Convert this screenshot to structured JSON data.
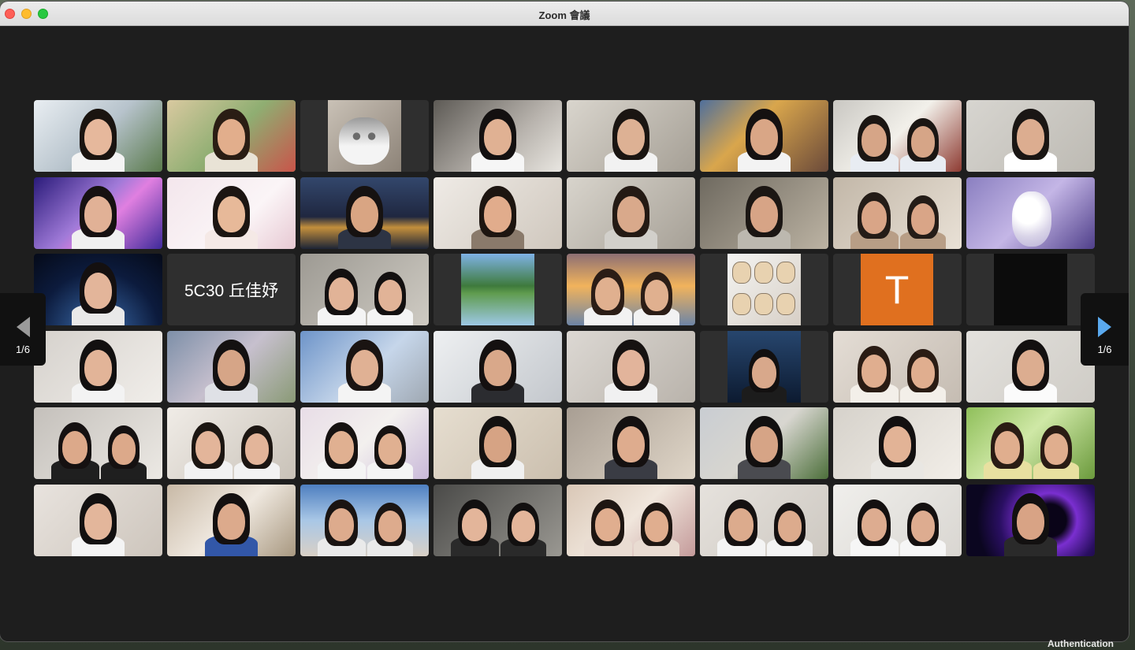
{
  "window": {
    "title": "Zoom 會議"
  },
  "navigation": {
    "prev_label": "1/6",
    "next_label": "1/6",
    "prev_icon": "chevron-left-icon",
    "next_icon": "chevron-right-icon"
  },
  "gallery": {
    "columns": 8,
    "rows": 6,
    "active_color": "#23d160",
    "tiles": [
      {
        "type": "video",
        "bg": "linear-gradient(135deg,#e9eef2,#b7c3cc 50%,#5a7a4c)",
        "people": 1,
        "skin": "#e6b89c",
        "hair": "#1a1410",
        "shirt": "#f4f4f4"
      },
      {
        "type": "video",
        "active": true,
        "bg": "linear-gradient(135deg,#d9c9a0,#8fae72 50%,#c9544a)",
        "people": 1,
        "skin": "#e2ae8c",
        "hair": "#2a1d14",
        "shirt": "#e9e3d6"
      },
      {
        "type": "video",
        "letterbox": true,
        "bg": "linear-gradient(135deg,#c9c1b6,#8d8378)",
        "people": 0,
        "extra": "cat"
      },
      {
        "type": "video",
        "bg": "linear-gradient(135deg,#5d5a55,#b8b3ad 60%,#e9e6e1)",
        "people": 1,
        "skin": "#e0b193",
        "hair": "#131010",
        "shirt": "#f6f6f6"
      },
      {
        "type": "video",
        "bg": "linear-gradient(135deg,#d9d5cd,#a59f95)",
        "people": 1,
        "skin": "#ddb194",
        "hair": "#1a1512",
        "shirt": "#f2f2f2"
      },
      {
        "type": "video",
        "bg": "linear-gradient(135deg,#4f6f9c,#d9a64c 40%,#6b4a3a)",
        "people": 1,
        "skin": "#d9a686",
        "hair": "#151111",
        "shirt": "#f3f3f3"
      },
      {
        "type": "video",
        "bg": "linear-gradient(135deg,#c9c7c2,#f2f0ea 50%,#8e3b32)",
        "people": 2,
        "skin": "#d6a587",
        "hair": "#1b1613",
        "shirt": "#e8ecf2"
      },
      {
        "type": "video",
        "bg": "linear-gradient(135deg,#d7d5d0,#bdbab3)",
        "people": 1,
        "skin": "#dcad90",
        "hair": "#1a1614",
        "shirt": "#ffffff"
      },
      {
        "type": "video",
        "bg": "linear-gradient(135deg,#2a1b7a,#a07ad8 45%,#e07fe0 60%,#3e2a9a)",
        "people": 1,
        "skin": "#e1b196",
        "hair": "#161111",
        "shirt": "#f0f0f0"
      },
      {
        "type": "video",
        "bg": "linear-gradient(135deg,#f3e6ec,#fbf5f7 60%,#e7c9d3)",
        "people": 1,
        "skin": "#e7b999",
        "hair": "#1c1512",
        "shirt": "#f5e9e6"
      },
      {
        "type": "video",
        "bg": "linear-gradient(180deg,#33476c,#1f2740 55%,#c38f3c 70%,#1d2436)",
        "people": 1,
        "skin": "#d9a583",
        "hair": "#161211",
        "shirt": "#2d3444"
      },
      {
        "type": "video",
        "bg": "linear-gradient(135deg,#efebe6,#cfc7bd)",
        "people": 1,
        "skin": "#e1ac8c",
        "hair": "#1d1510",
        "shirt": "#8a7a6b"
      },
      {
        "type": "video",
        "bg": "linear-gradient(135deg,#d8d4cc,#a6a096)",
        "people": 1,
        "skin": "#d9a98b",
        "hair": "#241a14",
        "shirt": "#d2d0cb"
      },
      {
        "type": "video",
        "bg": "linear-gradient(135deg,#6f6a60,#bcb3a3)",
        "people": 1,
        "skin": "#d7a486",
        "hair": "#1b1613",
        "shirt": "#bcb8af"
      },
      {
        "type": "video",
        "bg": "linear-gradient(135deg,#c2b7a8,#e9e1d6)",
        "people": 2,
        "skin": "#d9a587",
        "hair": "#241c17",
        "shirt": "#b89e86"
      },
      {
        "type": "video",
        "bg": "linear-gradient(135deg,#8a7fc0,#c4b6e6 50%,#4f3f8a)",
        "people": 0,
        "extra": "plush"
      },
      {
        "type": "video",
        "bg": "radial-gradient(circle at 50% 110%,#3d6fb0,#0c1b3d 60%,#050a18)",
        "people": 1,
        "skin": "#e3b59a",
        "hair": "#141010",
        "shirt": "#e9e9e9"
      },
      {
        "type": "name",
        "name": "5C30 丘佳妤"
      },
      {
        "type": "video",
        "bg": "linear-gradient(135deg,#9d9a93,#cfcbc3)",
        "people": 2,
        "skin": "#e1b397",
        "hair": "#131010",
        "shirt": "#f4f4f4"
      },
      {
        "type": "video",
        "letterbox": true,
        "bg": "linear-gradient(180deg,#7fb2e6,#3e7a3c 45%,#5f9b4e 55%,#9dc8e6)",
        "people": 0
      },
      {
        "type": "video",
        "bg": "linear-gradient(180deg,#8d6f74,#f1b35c 45%,#6d85a6)",
        "people": 2,
        "skin": "#e0b08f",
        "hair": "#2b1d16",
        "shirt": "#f2f2f2"
      },
      {
        "type": "video",
        "letterbox": true,
        "bg": "linear-gradient(135deg,#f4f4f2,#d7cfc6)",
        "people": 0,
        "extra": "cats"
      },
      {
        "type": "avatar",
        "letter": "T",
        "color": "#e0701f"
      },
      {
        "type": "video",
        "letterbox": true,
        "bg": "#0c0c0c",
        "people": 0
      },
      {
        "type": "video",
        "bg": "linear-gradient(135deg,#d5d1cc,#f1eeea)",
        "people": 1,
        "skin": "#e2b498",
        "hair": "#121010",
        "shirt": "#f3f3f3"
      },
      {
        "type": "video",
        "bg": "linear-gradient(135deg,#7d8fa8,#c7c0ce 50%,#8a9a76)",
        "people": 1,
        "skin": "#d6a587",
        "hair": "#141111",
        "shirt": "#dfe1e6"
      },
      {
        "type": "video",
        "bg": "linear-gradient(135deg,#6d94c9,#c6d6ea 55%,#9fa8b2)",
        "people": 1,
        "skin": "#e0b194",
        "hair": "#1a1412",
        "shirt": "#f4f4f4"
      },
      {
        "type": "video",
        "bg": "linear-gradient(135deg,#eef0f2,#c3c7cc)",
        "people": 1,
        "skin": "#d9a88a",
        "hair": "#141010",
        "shirt": "#2b2c30"
      },
      {
        "type": "video",
        "bg": "linear-gradient(135deg,#dcd8d3,#b9b3ab)",
        "people": 1,
        "skin": "#e2b49b",
        "hair": "#161211",
        "shirt": "#f1f1f1"
      },
      {
        "type": "video",
        "letterbox": true,
        "bg": "linear-gradient(180deg,#27466e,#0c1a30)",
        "people": 1,
        "skin": "#d8a88b",
        "hair": "#121010",
        "shirt": "#1c1c1c"
      },
      {
        "type": "video",
        "bg": "linear-gradient(135deg,#e4ddd5,#c5bcb2)",
        "people": 2,
        "skin": "#e0ae8f",
        "hair": "#2a1c14",
        "shirt": "#f3efe9"
      },
      {
        "type": "video",
        "bg": "linear-gradient(135deg,#e3e1dd,#cfccc6)",
        "people": 1,
        "skin": "#dcad90",
        "hair": "#131010",
        "shirt": "#fbfbfb"
      },
      {
        "type": "video",
        "bg": "linear-gradient(135deg,#c4c0bb,#ece9e4)",
        "people": 2,
        "skin": "#dca98a",
        "hair": "#151111",
        "shirt": "#1f1f1f"
      },
      {
        "type": "video",
        "bg": "linear-gradient(135deg,#f0ece7,#c9c2b8)",
        "people": 2,
        "skin": "#e3b59a",
        "hair": "#1c1612",
        "shirt": "#f2f2f2"
      },
      {
        "type": "video",
        "bg": "linear-gradient(135deg,#e8dde7,#f3f0ee 50%,#c9b9d9)",
        "people": 2,
        "skin": "#e0b091",
        "hair": "#161211",
        "shirt": "#f4f4f4"
      },
      {
        "type": "video",
        "bg": "linear-gradient(135deg,#e6ded0,#cbbfae)",
        "people": 1,
        "skin": "#d6a384",
        "hair": "#141110",
        "shirt": "#f0f0f0"
      },
      {
        "type": "video",
        "bg": "linear-gradient(135deg,#a89e93,#e0d6c8)",
        "people": 1,
        "skin": "#deac8e",
        "hair": "#141010",
        "shirt": "#3a3c44"
      },
      {
        "type": "video",
        "bg": "linear-gradient(135deg,#c9cdd2,#d8d6d0 50%,#4c6f3a)",
        "people": 1,
        "skin": "#d6a486",
        "hair": "#121010",
        "shirt": "#4a4b50"
      },
      {
        "type": "video",
        "bg": "linear-gradient(135deg,#d6d2cb,#f2eee8)",
        "people": 1,
        "skin": "#e2b396",
        "hair": "#131010",
        "shirt": "#e9e7e3"
      },
      {
        "type": "video",
        "bg": "linear-gradient(135deg,#8fbf5a,#cfe8a6 45%,#6b9a3c)",
        "people": 2,
        "skin": "#e0ae8e",
        "hair": "#2a1c14",
        "shirt": "#e8e0a0"
      },
      {
        "type": "video",
        "bg": "linear-gradient(135deg,#e8e3de,#cdc5bc)",
        "people": 1,
        "skin": "#e3b69b",
        "hair": "#121010",
        "shirt": "#f4f4f4"
      },
      {
        "type": "video",
        "bg": "linear-gradient(135deg,#c8b9a6,#efe8df 50%,#a89880)",
        "people": 1,
        "skin": "#dcaa8c",
        "hair": "#141010",
        "shirt": "#3257a8"
      },
      {
        "type": "video",
        "bg": "linear-gradient(180deg,#4e7fc0,#a9c7e6 50%,#d9d0c6)",
        "people": 2,
        "skin": "#ddab8d",
        "hair": "#1a1412",
        "shirt": "#eaeaea"
      },
      {
        "type": "video",
        "bg": "linear-gradient(135deg,#4a4a48,#9a9892)",
        "people": 2,
        "skin": "#e3b59a",
        "hair": "#121010",
        "shirt": "#2a2a2a"
      },
      {
        "type": "video",
        "bg": "linear-gradient(135deg,#d9c7b6,#f0e6dc 50%,#c49a9a)",
        "people": 2,
        "skin": "#e0ae8f",
        "hair": "#1e1612",
        "shirt": "#e9dcd2"
      },
      {
        "type": "video",
        "bg": "linear-gradient(135deg,#e6e2dd,#cdc8c1)",
        "people": 2,
        "skin": "#dcab8d",
        "hair": "#151111",
        "shirt": "#f4f4f4"
      },
      {
        "type": "video",
        "bg": "linear-gradient(135deg,#f0efec,#d9d6d1)",
        "people": 2,
        "skin": "#ddac90",
        "hair": "#141010",
        "shirt": "#f6f6f6"
      },
      {
        "type": "video",
        "bg": "radial-gradient(circle at 65% 50%,#0a0418 18%,#7a2fd0 30%,#2a0f62 55%,#0b0620 80%)",
        "people": 1,
        "skin": "#d8a385",
        "hair": "#121010",
        "shirt": "#2a2a2a"
      }
    ]
  },
  "background": {
    "corner_text": "Authentication"
  }
}
